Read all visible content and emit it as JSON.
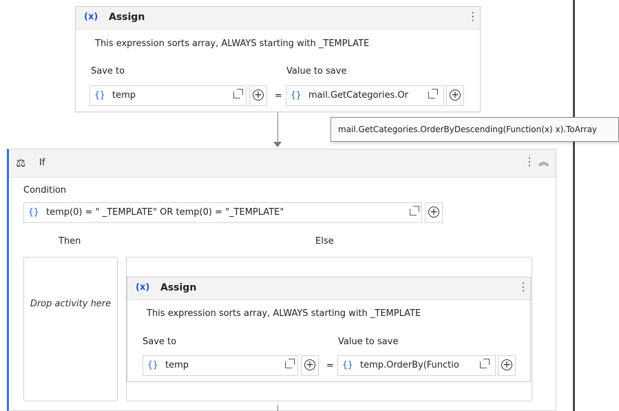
{
  "assign_top": {
    "icon": "variable-x-icon",
    "icon_glyph": "(x)",
    "title": "Assign",
    "description": "This expression sorts array, ALWAYS starting with _TEMPLATE",
    "save_to_label": "Save to",
    "value_to_save_label": "Value to save",
    "save_to_value": "temp",
    "value_to_save_value": "mail.GetCategories.Or",
    "equals": "="
  },
  "tooltip": {
    "text": "mail.GetCategories.OrderByDescending(Function(x) x).ToArray"
  },
  "if_activity": {
    "title": "If",
    "condition_label": "Condition",
    "condition_value": "temp(0) = \" _TEMPLATE\" OR temp(0) = \"_TEMPLATE\"",
    "then_label": "Then",
    "else_label": "Else",
    "drop_placeholder": "Drop activity here"
  },
  "assign_else": {
    "icon": "variable-x-icon",
    "icon_glyph": "(x)",
    "title": "Assign",
    "description": "This expression sorts array, ALWAYS starting with _TEMPLATE",
    "save_to_label": "Save to",
    "value_to_save_label": "Value to save",
    "save_to_value": "temp",
    "value_to_save_value": "temp.OrderBy(Functio",
    "equals": "="
  },
  "glyphs": {
    "braces": "{}",
    "kebab": "⋮",
    "plus": "+",
    "collapse": "︽",
    "if_icon": "⚖"
  },
  "colors": {
    "accent_blue": "#2f6fd3",
    "header_bg": "#f3f3f3"
  }
}
